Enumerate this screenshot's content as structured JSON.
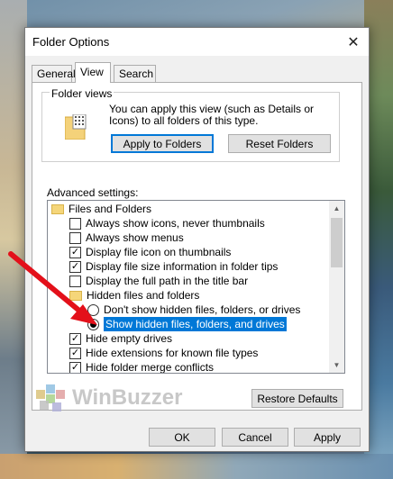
{
  "window": {
    "title": "Folder Options",
    "close_glyph": "✕"
  },
  "tabs": [
    {
      "label": "General",
      "active": false
    },
    {
      "label": "View",
      "active": true
    },
    {
      "label": "Search",
      "active": false
    }
  ],
  "folder_views": {
    "label": "Folder views",
    "description": "You can apply this view (such as Details or Icons) to all folders of this type.",
    "apply_button": "Apply to Folders",
    "reset_button": "Reset Folders"
  },
  "advanced": {
    "label": "Advanced settings:",
    "items": [
      {
        "type": "folder",
        "label": "Files and Folders"
      },
      {
        "type": "checkbox",
        "label": "Always show icons, never thumbnails",
        "checked": false
      },
      {
        "type": "checkbox",
        "label": "Always show menus",
        "checked": false
      },
      {
        "type": "checkbox",
        "label": "Display file icon on thumbnails",
        "checked": true
      },
      {
        "type": "checkbox",
        "label": "Display file size information in folder tips",
        "checked": true
      },
      {
        "type": "checkbox",
        "label": "Display the full path in the title bar",
        "checked": false
      },
      {
        "type": "folder",
        "label": "Hidden files and folders"
      },
      {
        "type": "radio",
        "label": "Don't show hidden files, folders, or drives",
        "checked": false
      },
      {
        "type": "radio",
        "label": "Show hidden files, folders, and drives",
        "checked": true,
        "selected": true
      },
      {
        "type": "checkbox",
        "label": "Hide empty drives",
        "checked": true
      },
      {
        "type": "checkbox",
        "label": "Hide extensions for known file types",
        "checked": true
      },
      {
        "type": "checkbox",
        "label": "Hide folder merge conflicts",
        "checked": true
      }
    ],
    "restore_button": "Restore Defaults"
  },
  "footer": {
    "ok": "OK",
    "cancel": "Cancel",
    "apply": "Apply"
  },
  "watermark": {
    "text": "WinBuzzer"
  },
  "colors": {
    "accent": "#0078d7",
    "arrow": "#e3101a"
  }
}
